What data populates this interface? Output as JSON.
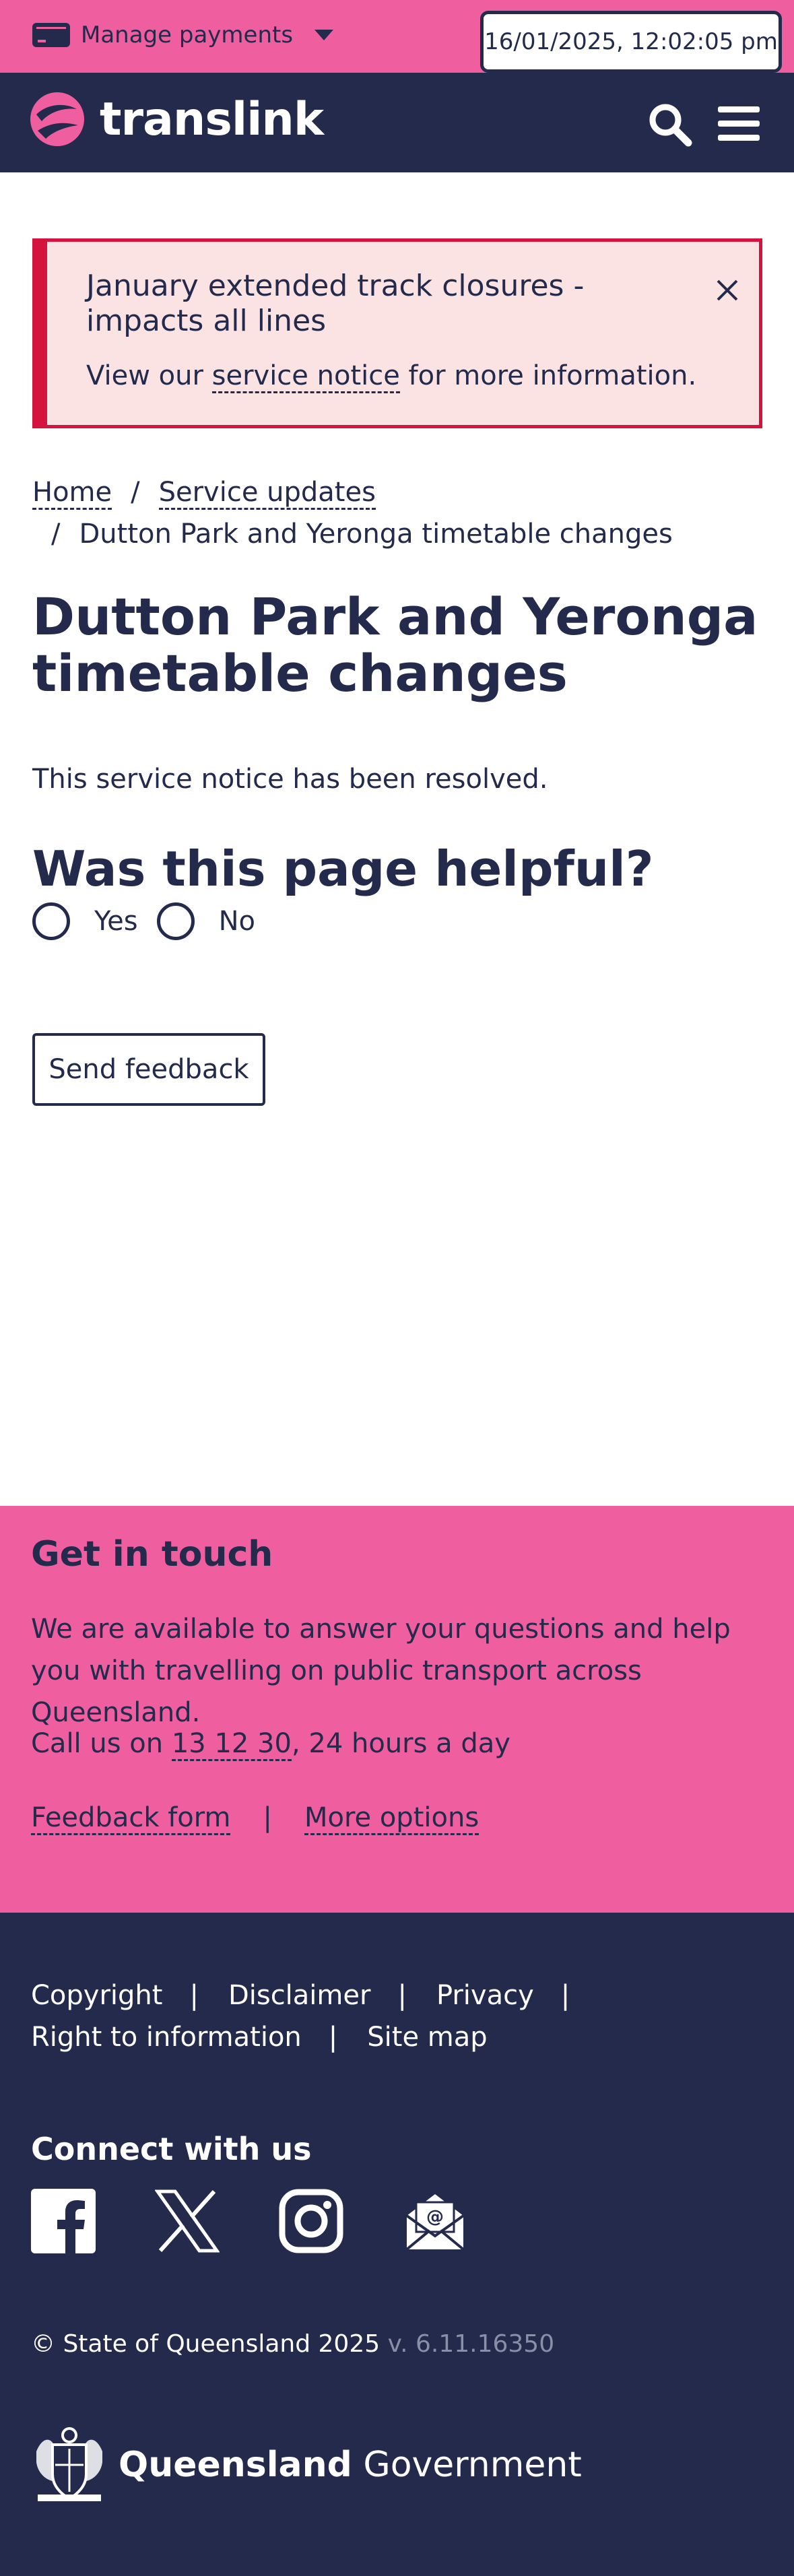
{
  "utility": {
    "manage_payments": "Manage payments",
    "datetime": "16/01/2025, 12:02:05 pm"
  },
  "nav": {
    "brand": "translink"
  },
  "alert": {
    "title": "January extended track closures - impacts all lines",
    "body_prefix": "View our ",
    "body_link": "service notice",
    "body_suffix": " for more information."
  },
  "breadcrumb": {
    "home": "Home",
    "sep": "/",
    "service_updates": "Service updates",
    "current": "Dutton Park and Yeronga timetable changes"
  },
  "main": {
    "title": "Dutton Park and Yeronga timetable changes",
    "resolved": "This service notice has been resolved.",
    "helpful_title": "Was this page helpful?",
    "yes": "Yes",
    "no": "No",
    "send_feedback": "Send feedback"
  },
  "touch": {
    "title": "Get in touch",
    "text": "We are available to answer your questions and help you with travelling on public transport across Queensland.",
    "call_prefix": "Call us on ",
    "call_number": "13 12 30",
    "call_suffix": ", 24 hours a day",
    "feedback_form": "Feedback form",
    "pipe": "|",
    "more_options": "More options"
  },
  "footer": {
    "copyright_link": "Copyright",
    "disclaimer": "Disclaimer",
    "privacy": "Privacy",
    "right_to_information": "Right to information",
    "site_map": "Site map",
    "pipe": "|",
    "connect_title": "Connect with us",
    "copyright_text": "© State of Queensland 2025",
    "version": " v. 6.11.16350",
    "gov_bold": "Queensland",
    "gov_rest": " Government"
  },
  "icons": {
    "payments": "card-icon",
    "menu": "caret-down-icon",
    "search": "search-icon",
    "hamburger": "menu-icon",
    "close": "close-icon",
    "facebook": "facebook-icon",
    "x": "x-icon",
    "instagram": "instagram-icon",
    "email": "email-icon",
    "crest": "queensland-crest-icon"
  },
  "colors": {
    "pink": "#ef5fa0",
    "navy": "#232a4b",
    "alert_red": "#d4143c",
    "alert_bg": "#fbe3e3"
  }
}
